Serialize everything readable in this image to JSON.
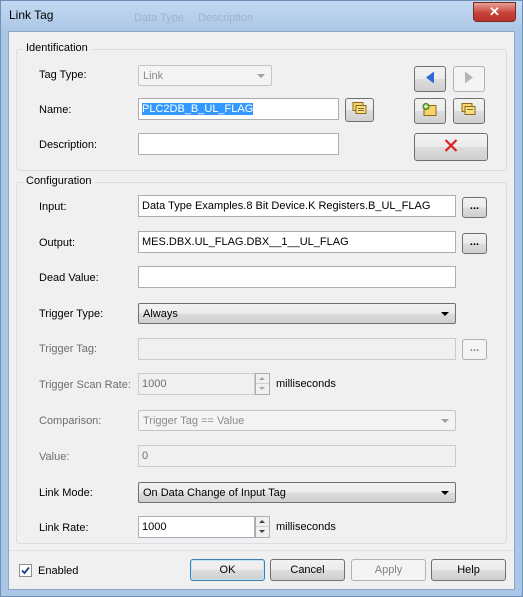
{
  "window": {
    "title": "Link Tag",
    "ghost_texts": [
      "Data Type",
      "Description"
    ],
    "close_glyph": "✕"
  },
  "identification": {
    "group_title": "Identification",
    "tag_type_label": "Tag Type:",
    "tag_type_value": "Link",
    "name_label": "Name:",
    "name_value": "PLC2DB_B_UL_FLAG",
    "description_label": "Description:",
    "description_value": ""
  },
  "configuration": {
    "group_title": "Configuration",
    "input_label": "Input:",
    "input_value": "Data Type Examples.8 Bit Device.K Registers.B_UL_FLAG",
    "output_label": "Output:",
    "output_value": "MES.DBX.UL_FLAG.DBX__1__UL_FLAG",
    "dead_value_label": "Dead Value:",
    "dead_value_value": "",
    "trigger_type_label": "Trigger Type:",
    "trigger_type_value": "Always",
    "trigger_tag_label": "Trigger Tag:",
    "trigger_tag_value": "",
    "trigger_scan_rate_label": "Trigger Scan Rate:",
    "trigger_scan_rate_value": "1000",
    "trigger_scan_rate_unit": "milliseconds",
    "comparison_label": "Comparison:",
    "comparison_value": "Trigger Tag == Value",
    "value_label": "Value:",
    "value_value": "0",
    "link_mode_label": "Link Mode:",
    "link_mode_value": "On Data Change of Input Tag",
    "link_rate_label": "Link Rate:",
    "link_rate_value": "1000",
    "link_rate_unit": "milliseconds",
    "browse_glyph": "..."
  },
  "footer": {
    "enabled_label": "Enabled",
    "enabled_checked": true,
    "check_glyph": "✓",
    "ok_label": "OK",
    "cancel_label": "Cancel",
    "apply_label": "Apply",
    "help_label": "Help"
  },
  "colors": {
    "accent_blue": "#3399ff",
    "delete_red": "#e02020",
    "nav_blue": "#2b6ad6"
  }
}
